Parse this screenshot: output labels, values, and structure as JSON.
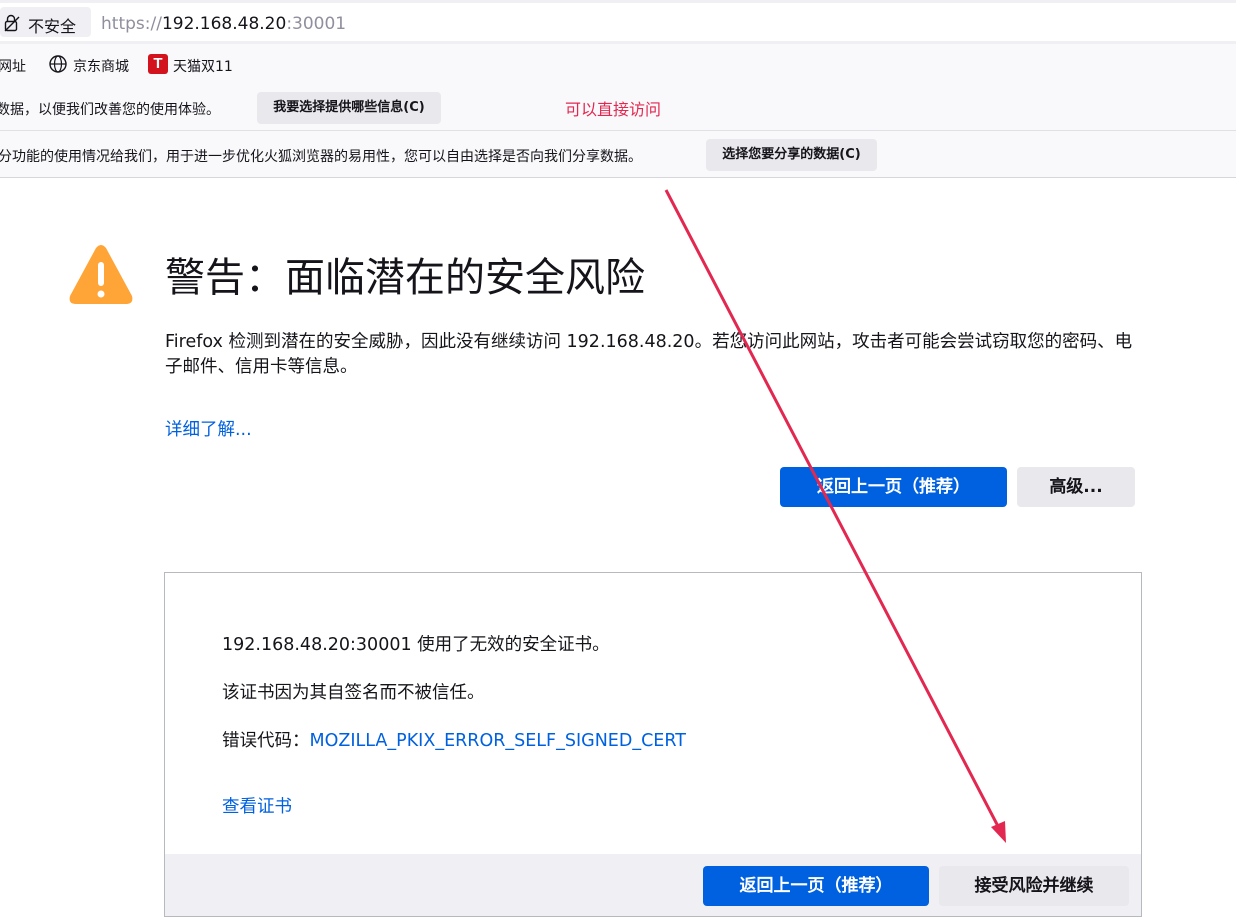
{
  "urlbar": {
    "security_label": "不安全",
    "url_scheme": "https://",
    "url_host": "192.168.48.20",
    "url_port": ":30001"
  },
  "bookmarks": {
    "items": [
      {
        "label": "网址"
      },
      {
        "label": "京东商城",
        "icon": "globe-icon"
      },
      {
        "label": "天猫双11",
        "icon": "tmall-icon"
      }
    ],
    "tmall_glyph": "T"
  },
  "notifications": [
    {
      "text": "数据，以便我们改善您的使用体验。",
      "button": "我要选择提供哪些信息(C)"
    },
    {
      "text": "分功能的使用情况给我们，用于进一步优化火狐浏览器的易用性，您可以自由选择是否向我们分享数据。",
      "button": "选择您要分享的数据(C)"
    }
  ],
  "annotation": {
    "text": "可以直接访问",
    "color": "#e22850"
  },
  "warning": {
    "title": "警告：面临潜在的安全风险",
    "description": "Firefox 检测到潜在的安全威胁，因此没有继续访问 192.168.48.20。若您访问此网站，攻击者可能会尝试窃取您的密码、电子邮件、信用卡等信息。",
    "learn_more": "详细了解...",
    "go_back_button": "返回上一页（推荐）",
    "advanced_button": "高级..."
  },
  "advanced": {
    "line1": "192.168.48.20:30001 使用了无效的安全证书。",
    "line2": "该证书因为其自签名而不被信任。",
    "error_label": "错误代码：",
    "error_code": "MOZILLA_PKIX_ERROR_SELF_SIGNED_CERT",
    "view_cert": "查看证书",
    "go_back_button": "返回上一页（推荐）",
    "accept_button": "接受风险并继续"
  },
  "colors": {
    "accent": "#0061e0",
    "warning": "#ffa436",
    "annotation_arrow": "#e22850"
  }
}
